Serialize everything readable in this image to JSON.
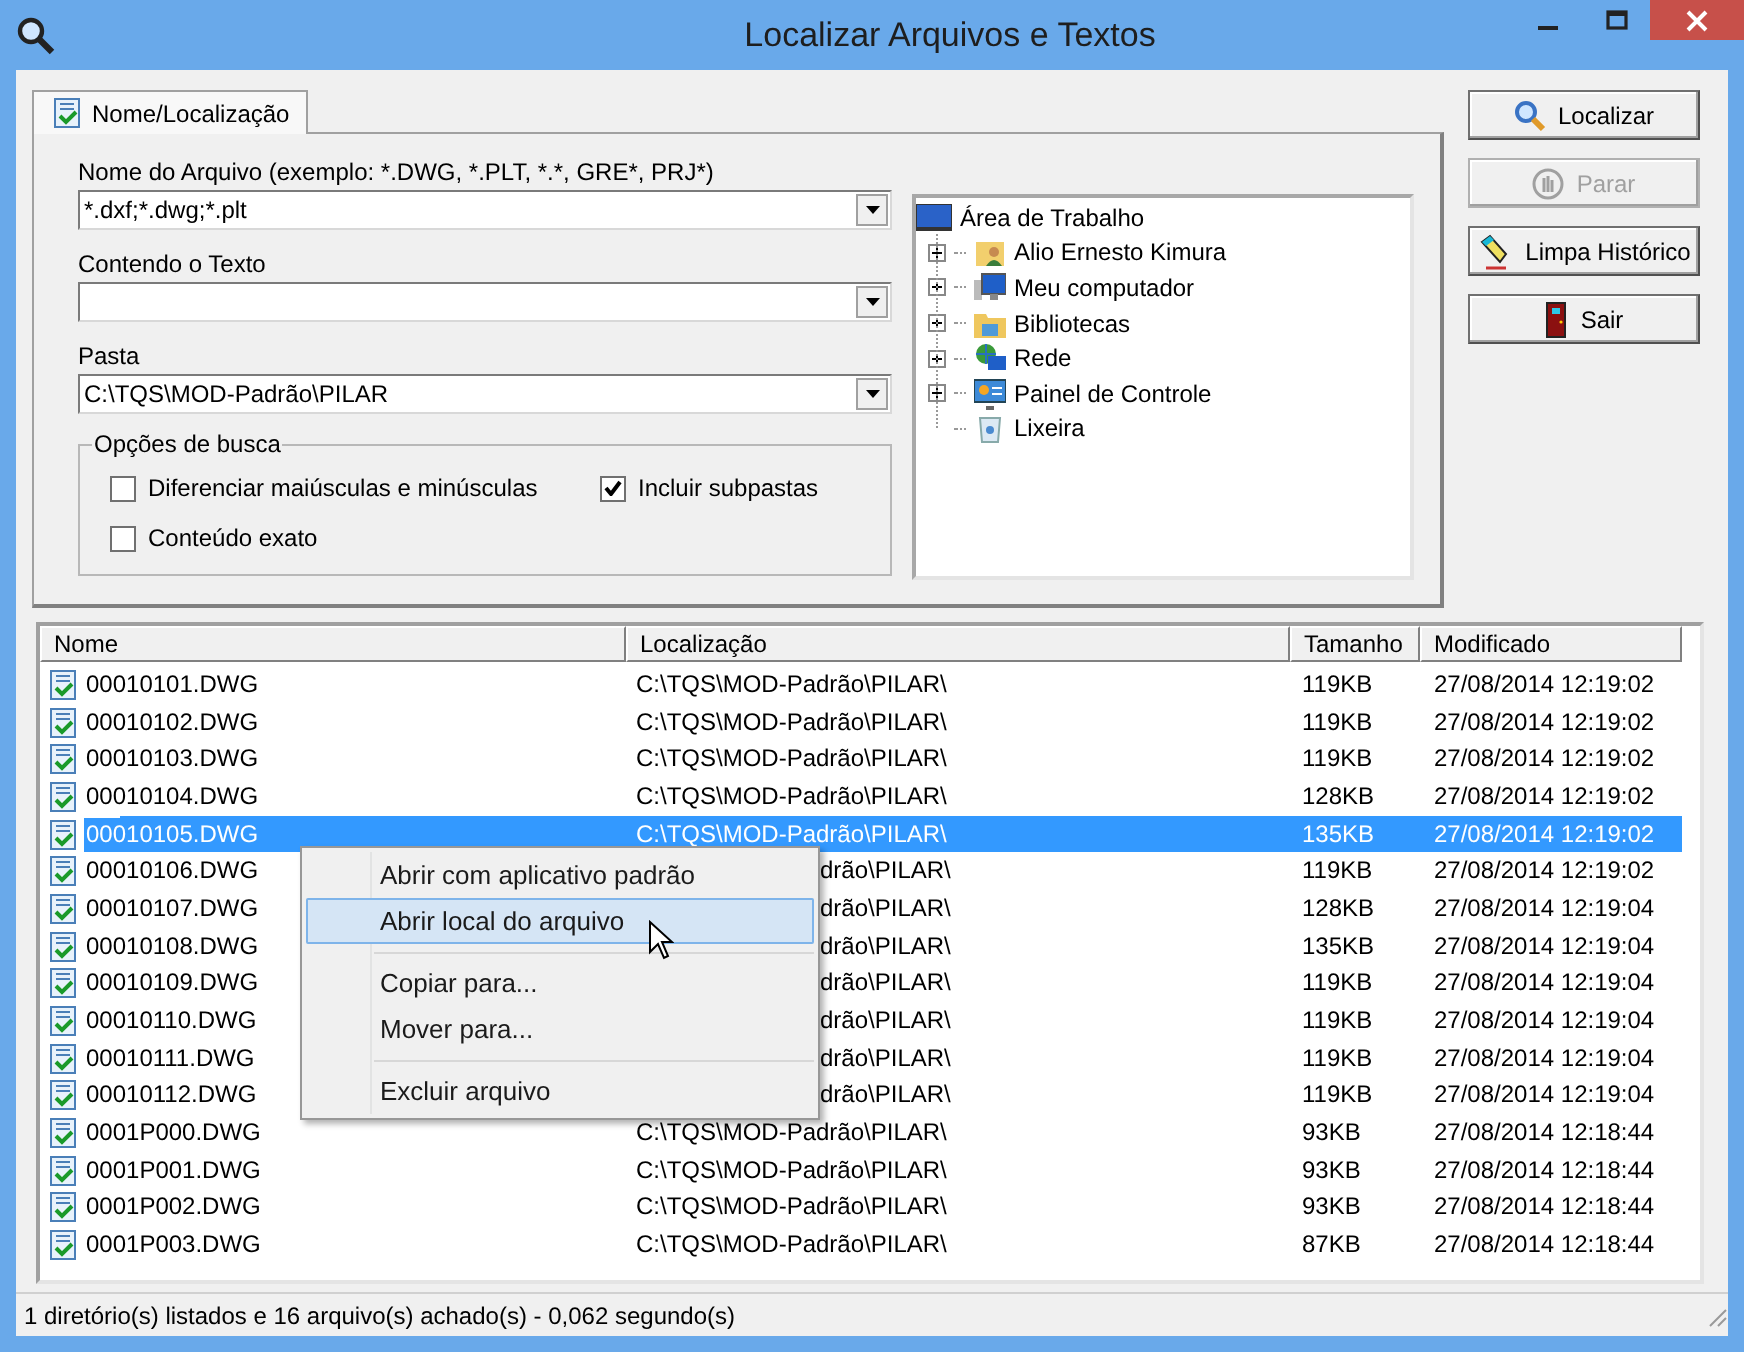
{
  "window": {
    "title": "Localizar Arquivos e Textos"
  },
  "tabs": [
    {
      "label": "Nome/Localização",
      "selected": true
    }
  ],
  "fields": [
    {
      "label": "Nome do Arquivo (exemplo: *.DWG, *.PLT, *.*, GRE*, PRJ*)",
      "value": "*.dxf;*.dwg;*.plt"
    },
    {
      "label": "Contendo o Texto"
    },
    {
      "label": "Pasta",
      "value": "C:\\TQS\\MOD-Padrão\\PILAR"
    }
  ],
  "search_options": {
    "title": "Opções de busca",
    "options": [
      {
        "label": "Diferenciar maiúsculas e minúsculas",
        "checked": false
      },
      {
        "label": "Incluir subpastas",
        "checked": true
      },
      {
        "label": "Conteúdo exato",
        "checked": false
      }
    ]
  },
  "folder_tree": {
    "label": "Área de Trabalho",
    "children": [
      {
        "label": "Alio Ernesto Kimura",
        "expandable": true
      },
      {
        "label": "Meu computador",
        "expandable": true
      },
      {
        "label": "Bibliotecas",
        "expandable": true
      },
      {
        "label": "Rede",
        "expandable": true
      },
      {
        "label": "Painel de Controle",
        "expandable": true
      },
      {
        "label": "Lixeira",
        "expandable": false
      }
    ]
  },
  "buttons": [
    {
      "label": "Localizar",
      "disabled": false
    },
    {
      "label": "Parar",
      "disabled": true
    },
    {
      "label": "Limpa Histórico",
      "disabled": false
    },
    {
      "label": "Sair",
      "disabled": false
    }
  ],
  "table": {
    "columns": [
      "Nome",
      "Localização",
      "Tamanho",
      "Modificado"
    ],
    "rows": [
      {
        "name": "00010101.DWG",
        "location": "C:\\TQS\\MOD-Padrão\\PILAR\\",
        "size": "119KB",
        "modified": "27/08/2014 12:19:02",
        "selected": false
      },
      {
        "name": "00010102.DWG",
        "location": "C:\\TQS\\MOD-Padrão\\PILAR\\",
        "size": "119KB",
        "modified": "27/08/2014 12:19:02",
        "selected": false
      },
      {
        "name": "00010103.DWG",
        "location": "C:\\TQS\\MOD-Padrão\\PILAR\\",
        "size": "119KB",
        "modified": "27/08/2014 12:19:02",
        "selected": false
      },
      {
        "name": "00010104.DWG",
        "location": "C:\\TQS\\MOD-Padrão\\PILAR\\",
        "size": "128KB",
        "modified": "27/08/2014 12:19:02",
        "selected": false
      },
      {
        "name": "00010105.DWG",
        "location": "C:\\TQS\\MOD-Padrão\\PILAR\\",
        "size": "135KB",
        "modified": "27/08/2014 12:19:02",
        "selected": true
      },
      {
        "name": "00010106.DWG",
        "location": "drão\\PILAR\\",
        "location_covered": true,
        "size": "119KB",
        "modified": "27/08/2014 12:19:02",
        "selected": false
      },
      {
        "name": "00010107.DWG",
        "location": "drão\\PILAR\\",
        "location_covered": true,
        "size": "128KB",
        "modified": "27/08/2014 12:19:04",
        "selected": false
      },
      {
        "name": "00010108.DWG",
        "location": "drão\\PILAR\\",
        "location_covered": true,
        "size": "135KB",
        "modified": "27/08/2014 12:19:04",
        "selected": false
      },
      {
        "name": "00010109.DWG",
        "location": "drão\\PILAR\\",
        "location_covered": true,
        "size": "119KB",
        "modified": "27/08/2014 12:19:04",
        "selected": false
      },
      {
        "name": "00010110.DWG",
        "location": "drão\\PILAR\\",
        "location_covered": true,
        "size": "119KB",
        "modified": "27/08/2014 12:19:04",
        "selected": false
      },
      {
        "name": "00010111.DWG",
        "location": "drão\\PILAR\\",
        "location_covered": true,
        "size": "119KB",
        "modified": "27/08/2014 12:19:04",
        "selected": false
      },
      {
        "name": "00010112.DWG",
        "location": "drão\\PILAR\\",
        "location_covered": true,
        "size": "119KB",
        "modified": "27/08/2014 12:19:04",
        "selected": false
      },
      {
        "name": "0001P000.DWG",
        "location": "C:\\TQS\\MOD-Padrão\\PILAR\\",
        "size": "93KB",
        "modified": "27/08/2014 12:18:44",
        "selected": false
      },
      {
        "name": "0001P001.DWG",
        "location": "C:\\TQS\\MOD-Padrão\\PILAR\\",
        "size": "93KB",
        "modified": "27/08/2014 12:18:44",
        "selected": false
      },
      {
        "name": "0001P002.DWG",
        "location": "C:\\TQS\\MOD-Padrão\\PILAR\\",
        "size": "93KB",
        "modified": "27/08/2014 12:18:44",
        "selected": false
      },
      {
        "name": "0001P003.DWG",
        "location": "C:\\TQS\\MOD-Padrão\\PILAR\\",
        "size": "87KB",
        "modified": "27/08/2014 12:18:44",
        "selected": false
      }
    ]
  },
  "context_menu": {
    "items": [
      {
        "kind": "item",
        "label": "Abrir com aplicativo padrão",
        "hovered": false
      },
      {
        "kind": "item",
        "label": "Abrir local do arquivo",
        "hovered": true
      },
      {
        "kind": "separator"
      },
      {
        "kind": "item",
        "label": "Copiar para...",
        "hovered": false
      },
      {
        "kind": "item",
        "label": "Mover para...",
        "hovered": false
      },
      {
        "kind": "separator"
      },
      {
        "kind": "item",
        "label": "Excluir arquivo",
        "hovered": false
      }
    ]
  },
  "status_bar": {
    "text": "1 diretório(s) listados e 16 arquivo(s) achado(s) - 0,062 segundo(s)"
  }
}
